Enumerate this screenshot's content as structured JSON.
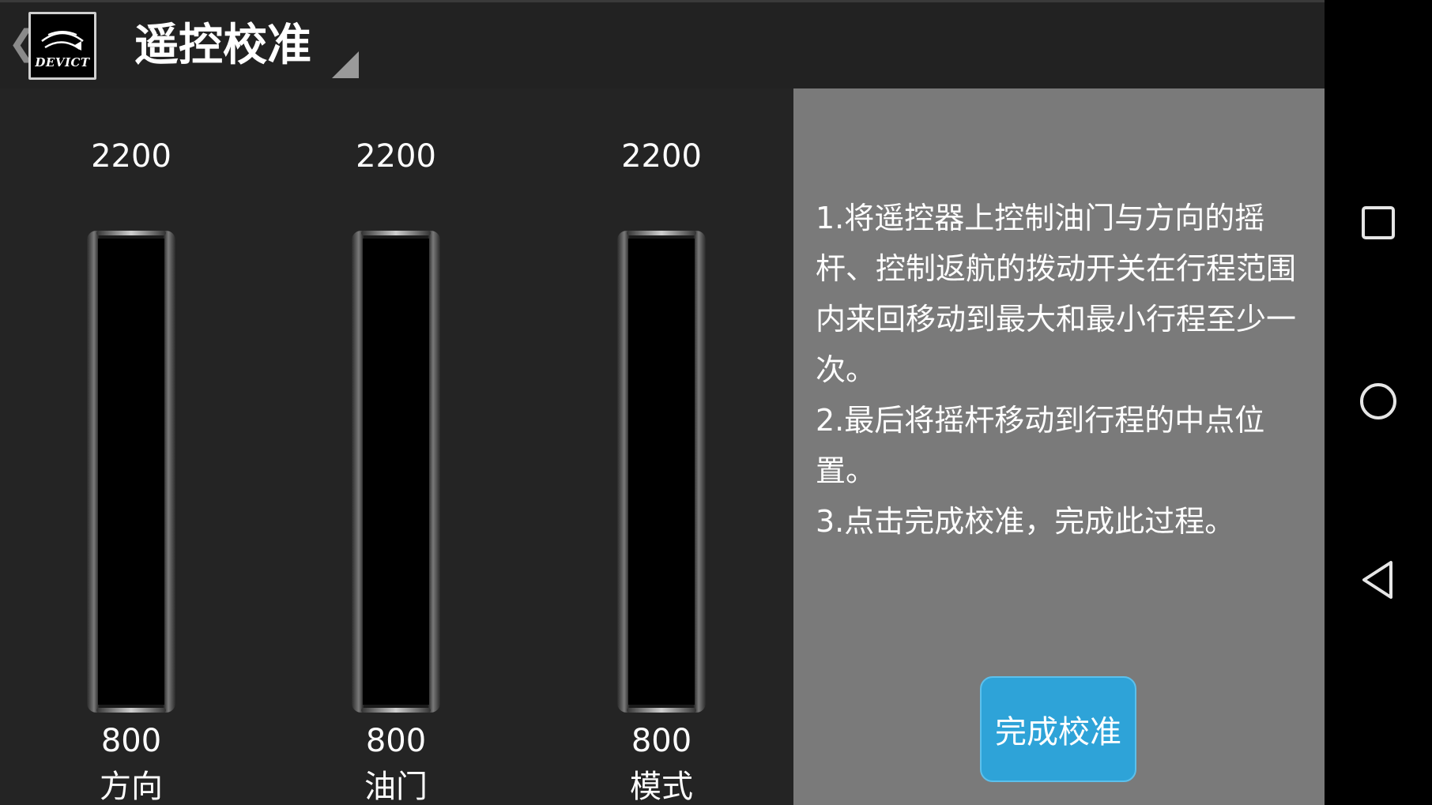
{
  "header": {
    "back_icon": "chevron-left-icon",
    "logo_text": "DEVICT",
    "title": "遥控校准"
  },
  "channels": [
    {
      "name": "方向",
      "max": "2200",
      "min": "800"
    },
    {
      "name": "油门",
      "max": "2200",
      "min": "800"
    },
    {
      "name": "模式",
      "max": "2200",
      "min": "800"
    }
  ],
  "instructions": {
    "step1": "1.将遥控器上控制油门与方向的摇杆、控制返航的拨动开关在行程范围内来回移动到最大和最小行程至少一次。",
    "step2": "2.最后将摇杆移动到行程的中点位置。",
    "step3": "3.点击完成校准，完成此过程。"
  },
  "complete_button": {
    "label": "完成校准"
  },
  "nav_bar": {
    "recents_icon": "square-icon",
    "home_icon": "circle-icon",
    "back_icon": "triangle-back-icon"
  },
  "colors": {
    "action_bar": "#222222",
    "background": "#242424",
    "panel": "#7a7a7a",
    "button": "#2ea3d8"
  }
}
